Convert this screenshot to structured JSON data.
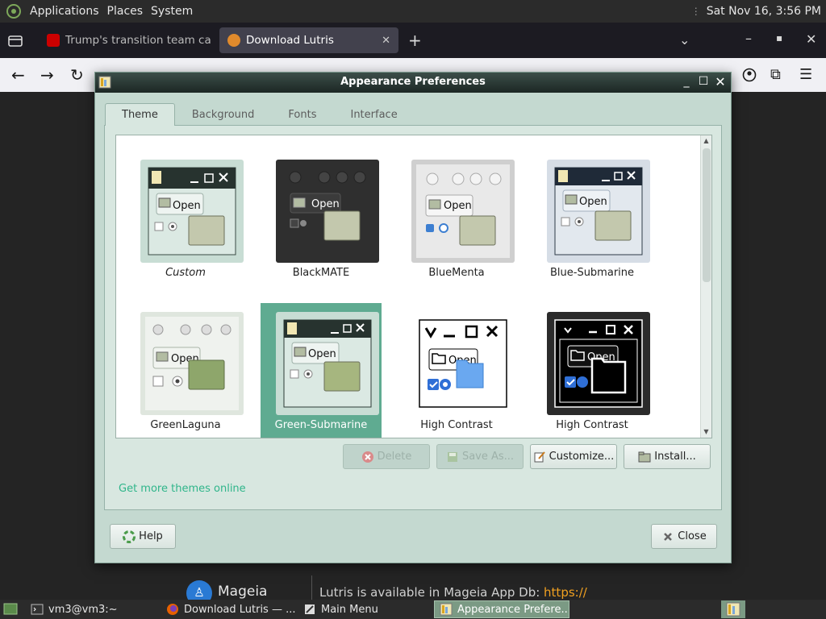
{
  "top_panel": {
    "menus": [
      "Applications",
      "Places",
      "System"
    ],
    "clock": "Sat Nov 16,  3:56 PM"
  },
  "browser": {
    "tabs": [
      {
        "title": "Trump's transition team ca",
        "favicon": "cnn-icon",
        "active": false
      },
      {
        "title": "Download Lutris",
        "favicon": "lutris-icon",
        "active": true
      }
    ]
  },
  "dialog": {
    "title": "Appearance Preferences",
    "tabs": [
      "Theme",
      "Background",
      "Fonts",
      "Interface"
    ],
    "active_tab": "Theme",
    "themes": [
      {
        "name": "Custom"
      },
      {
        "name": "BlackMATE"
      },
      {
        "name": "BlueMenta"
      },
      {
        "name": "Blue-Submarine"
      },
      {
        "name": "GreenLaguna"
      },
      {
        "name": "Green-Submarine",
        "selected": true
      },
      {
        "name": "High Contrast"
      },
      {
        "name": "High Contrast"
      }
    ],
    "thumb_text": "Open",
    "buttons": {
      "delete": "Delete",
      "save_as": "Save As...",
      "customize": "Customize...",
      "install": "Install..."
    },
    "get_more": "Get more themes online",
    "help": "Help",
    "close": "Close"
  },
  "page_footer": {
    "logo_text": "Mageia",
    "text": "Lutris is available in Mageia App Db: ",
    "link": "https://"
  },
  "taskbar": {
    "items": [
      {
        "label": "vm3@vm3:~"
      },
      {
        "label": "Download Lutris — ..."
      },
      {
        "label": "Main Menu"
      },
      {
        "label": "Appearance Prefere...",
        "active": true
      }
    ]
  },
  "colors": {
    "dialog_bg": "#c4d9d0",
    "selection": "#5fab91",
    "link": "#2fb58a"
  }
}
